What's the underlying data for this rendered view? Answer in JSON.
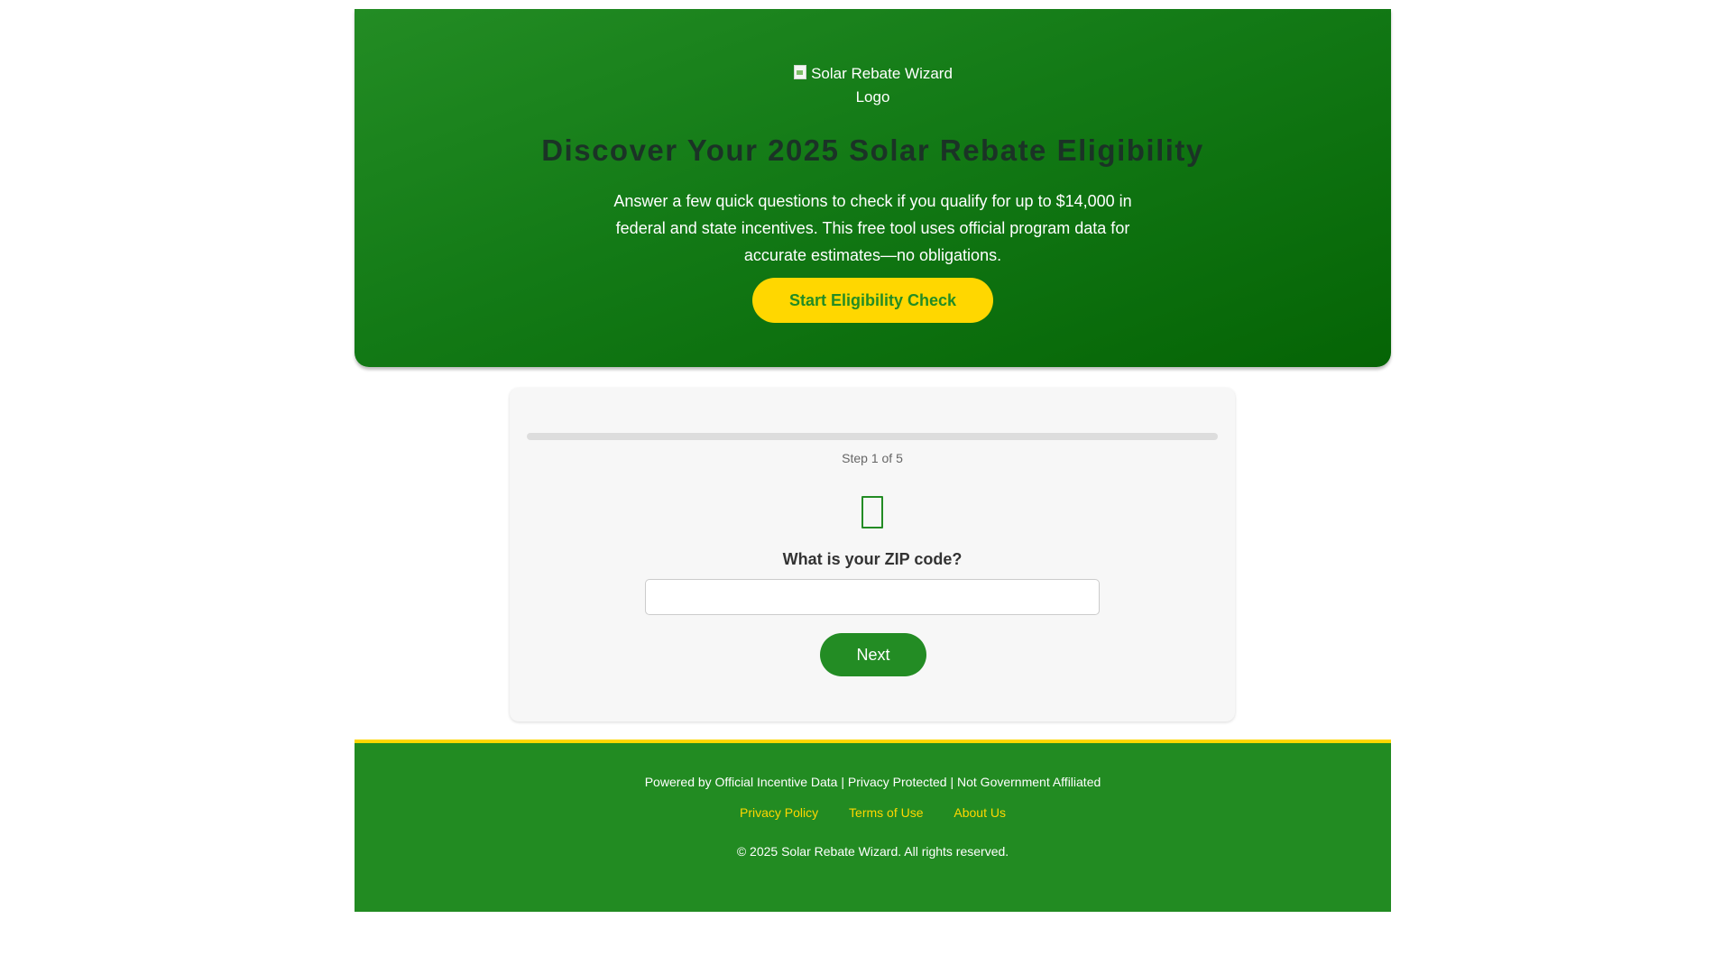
{
  "hero": {
    "logo_alt": "Solar Rebate Wizard Logo",
    "title": "Discover Your 2025 Solar Rebate Eligibility",
    "subtitle": "Answer a few quick questions to check if you qualify for up to $14,000 in federal and state incentives. This free tool uses official program data for accurate estimates—no obligations.",
    "cta_label": "Start Eligibility Check"
  },
  "wizard": {
    "progress": 0,
    "step_label": "Step 1 of 5",
    "question_icon": "missing-glyph-icon",
    "question": "What is your ZIP code?",
    "zip_value": "",
    "zip_placeholder": "",
    "next_label": "Next"
  },
  "footer": {
    "note": "Powered by Official Incentive Data | Privacy Protected | Not Government Affiliated",
    "links": [
      {
        "label": "Privacy Policy"
      },
      {
        "label": "Terms of Use"
      },
      {
        "label": "About Us"
      }
    ],
    "copyright": "© 2025 Solar Rebate Wizard. All rights reserved."
  },
  "colors": {
    "brand_green": "#228b22",
    "accent_yellow": "#ffd700",
    "title_dark": "#1b3326"
  }
}
